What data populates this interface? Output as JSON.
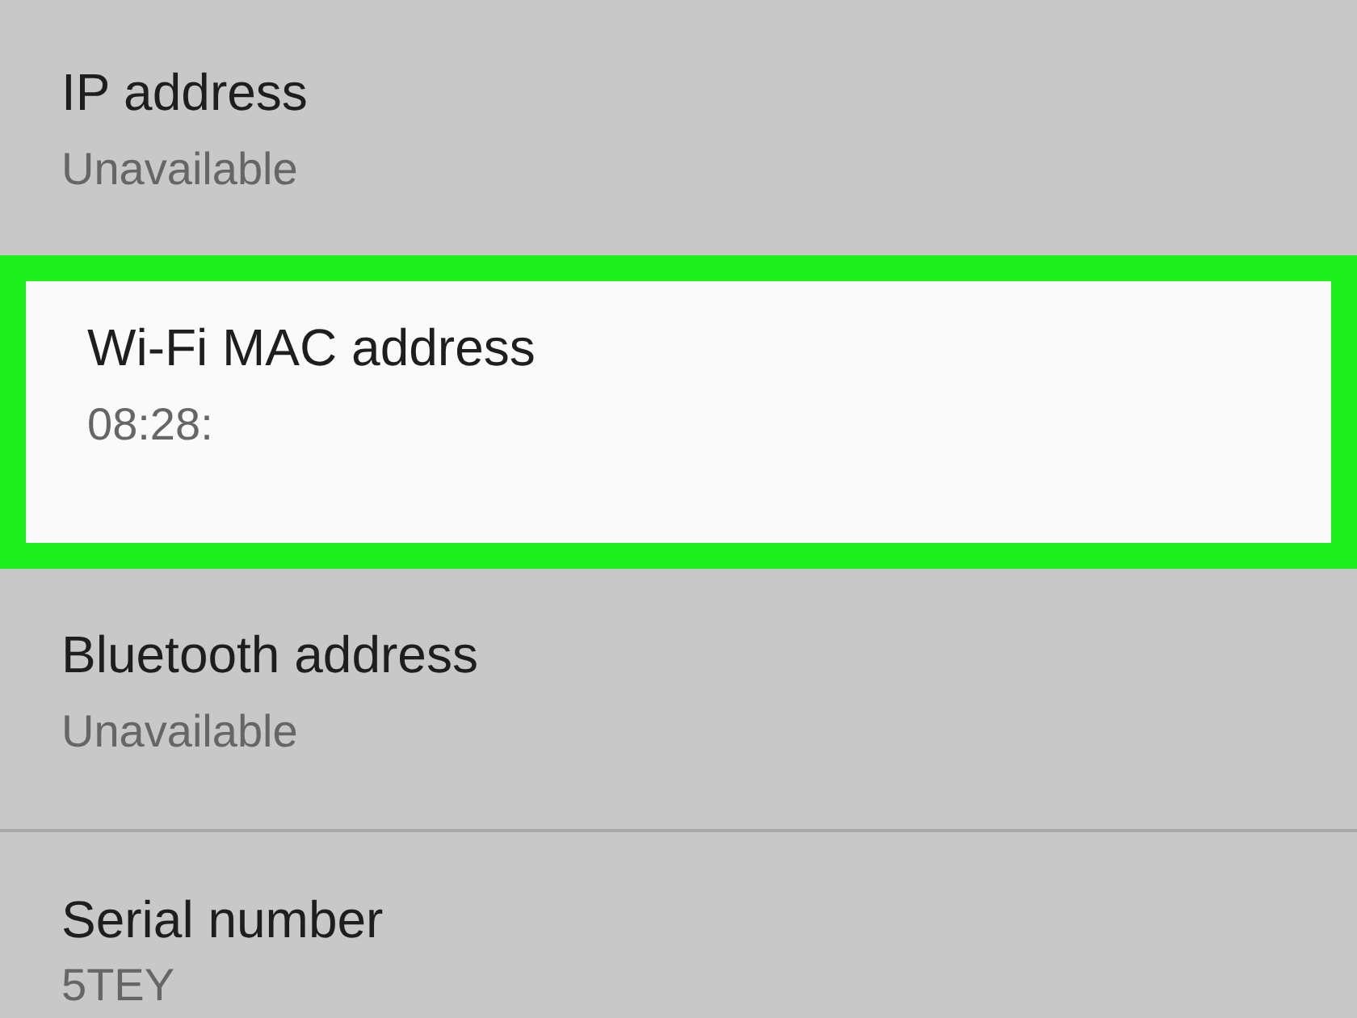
{
  "items": [
    {
      "title": "IP address",
      "value": "Unavailable",
      "highlighted": false,
      "divider_below": false
    },
    {
      "title": "Wi-Fi MAC address",
      "value": "08:28:",
      "highlighted": true,
      "divider_below": false
    },
    {
      "title": "Bluetooth address",
      "value": "Unavailable",
      "highlighted": false,
      "divider_below": true
    },
    {
      "title": "Serial number",
      "value": "5TEY",
      "highlighted": false,
      "divider_below": false
    }
  ]
}
